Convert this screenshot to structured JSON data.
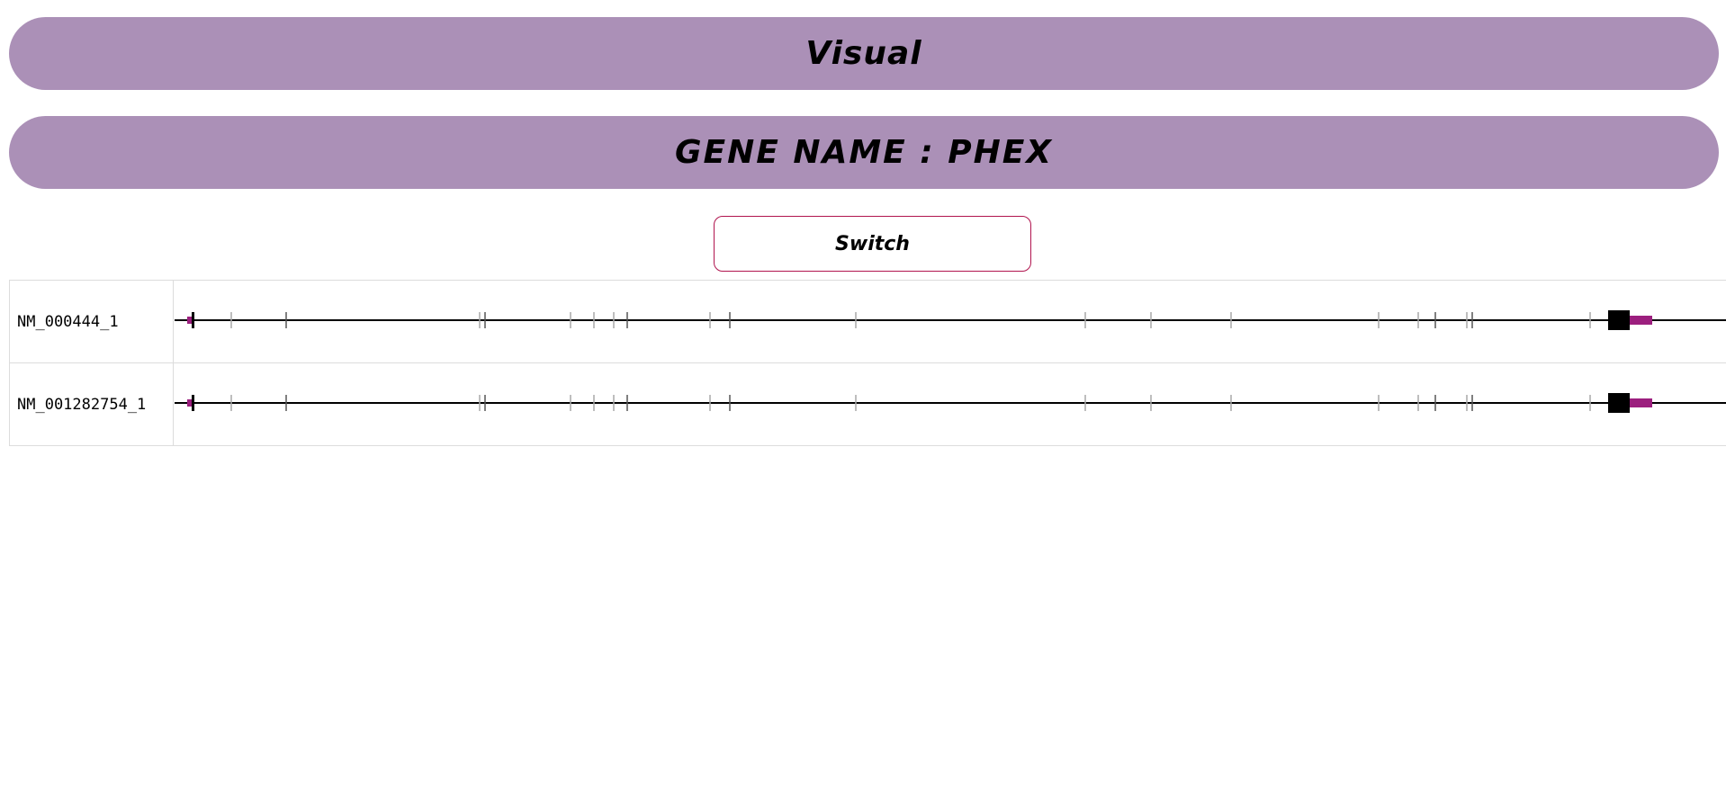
{
  "header": {
    "title": "Visual",
    "gene_label": "GENE NAME : PHEX"
  },
  "controls": {
    "switch_label": "Switch"
  },
  "colors": {
    "banner_bg": "#ab90b7",
    "switch_border": "#b0144e",
    "utr": "#9c1f7e",
    "exon": "#000000",
    "faint_exon": "#a9a9a9",
    "intron_line": "#000000"
  },
  "transcripts": [
    {
      "id": "NM_000444_1"
    },
    {
      "id": "NM_001282754_1"
    }
  ]
}
